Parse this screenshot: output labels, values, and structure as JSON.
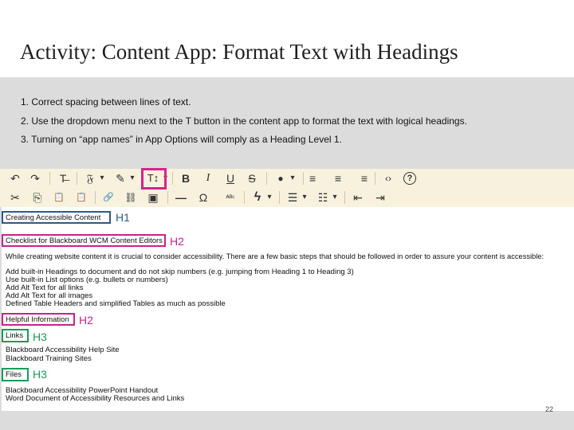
{
  "title": "Activity: Content App: Format Text with Headings",
  "instructions": [
    "1. Correct spacing between lines of text.",
    "2. Use the  dropdown menu next to the T button in the content app to format the text with logical headings.",
    "3. Turning on “app names” in App Options will comply as a Heading Level 1."
  ],
  "toolbar": {
    "row1": [
      {
        "name": "undo-icon",
        "glyph": "↶"
      },
      {
        "name": "redo-icon",
        "glyph": "↷"
      },
      {
        "name": "clear-format-icon",
        "glyph": "T̶"
      },
      {
        "name": "font-family-icon",
        "glyph": "𝔉"
      },
      {
        "name": "dropdown-arrow-icon",
        "glyph": "▾"
      },
      {
        "name": "highlighter-icon",
        "glyph": "✎"
      },
      {
        "name": "dropdown-arrow-icon",
        "glyph": "▾"
      },
      {
        "name": "text-size-icon",
        "glyph": "T↕"
      },
      {
        "name": "dropdown-arrow-icon",
        "glyph": "▾"
      },
      {
        "name": "bold-icon",
        "glyph": "B"
      },
      {
        "name": "italic-icon",
        "glyph": "I"
      },
      {
        "name": "underline-icon",
        "glyph": "U"
      },
      {
        "name": "strikethrough-icon",
        "glyph": "S"
      },
      {
        "name": "color-drop-icon",
        "glyph": "●"
      },
      {
        "name": "dropdown-arrow-icon",
        "glyph": "▾"
      },
      {
        "name": "align-left-icon",
        "glyph": "≡"
      },
      {
        "name": "align-center-icon",
        "glyph": "≡"
      },
      {
        "name": "align-right-icon",
        "glyph": "≡"
      },
      {
        "name": "code-icon",
        "glyph": "‹›"
      },
      {
        "name": "help-icon",
        "glyph": "?"
      }
    ],
    "row2": [
      {
        "name": "cut-icon",
        "glyph": "✂"
      },
      {
        "name": "copy-icon",
        "glyph": "⎘"
      },
      {
        "name": "paste-icon",
        "glyph": "📋"
      },
      {
        "name": "paste-plain-icon",
        "glyph": "📋"
      },
      {
        "name": "link-icon",
        "glyph": "🔗"
      },
      {
        "name": "unlink-icon",
        "glyph": "⛓"
      },
      {
        "name": "image-icon",
        "glyph": "▣"
      },
      {
        "name": "horizontal-rule-icon",
        "glyph": "—"
      },
      {
        "name": "omega-icon",
        "glyph": "Ω"
      },
      {
        "name": "spellcheck-icon",
        "glyph": "ᴬᴮᶜ"
      },
      {
        "name": "lightning-icon",
        "glyph": "ϟ"
      },
      {
        "name": "dropdown-arrow-icon",
        "glyph": "▾"
      },
      {
        "name": "bullet-list-icon",
        "glyph": "☰"
      },
      {
        "name": "dropdown-arrow-icon",
        "glyph": "▾"
      },
      {
        "name": "numbered-list-icon",
        "glyph": "☷"
      },
      {
        "name": "dropdown-arrow-icon",
        "glyph": "▾"
      },
      {
        "name": "outdent-icon",
        "glyph": "⇤"
      },
      {
        "name": "indent-icon",
        "glyph": "⇥"
      }
    ]
  },
  "doc": {
    "lines": [
      {
        "text": "Creating Accessible Content"
      },
      {
        "text": "Checklist for Blackboard WCM Content Editors"
      },
      {
        "text": "While creating website content it is crucial to consider accessibility. There are a few basic steps that should be followed in order to assure your content is accessible:"
      },
      {
        "text": "Add built-in Headings to document and do not skip numbers (e.g. jumping from Heading 1 to Heading 3)"
      },
      {
        "text": "Use built-in List options (e.g. bullets or numbers)"
      },
      {
        "text": "Add Alt Text for all links"
      },
      {
        "text": "Add Alt Text for all images"
      },
      {
        "text": "Defined Table Headers and simplified Tables as much as possible"
      },
      {
        "text": "Helpful Information"
      },
      {
        "text": "Links"
      },
      {
        "text": "Blackboard Accessibility Help Site"
      },
      {
        "text": "Blackboard Training Sites"
      },
      {
        "text": "Files"
      },
      {
        "text": "Blackboard Accessibility PowerPoint Handout"
      },
      {
        "text": "Word Document of Accessibility Resources and Links"
      }
    ],
    "heading_labels": [
      "H1",
      "H2",
      "H2",
      "H3",
      "H3"
    ]
  },
  "page_number": "22"
}
